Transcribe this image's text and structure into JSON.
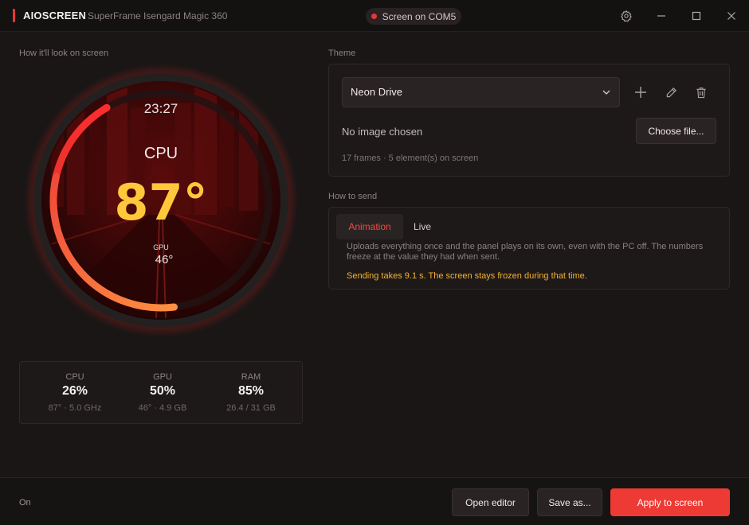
{
  "titlebar": {
    "brand": "AIOSCREEN",
    "device": "SuperFrame Isengard Magic 360",
    "status": "Screen on COM5"
  },
  "preview": {
    "label": "How it'll look on screen",
    "clock": "23:27",
    "primary_label": "CPU",
    "primary_value": "87°",
    "secondary_label": "GPU",
    "secondary_value": "46°",
    "primary_level": 0.87,
    "secondary_level": 0.46
  },
  "stats": [
    {
      "label": "CPU",
      "value": "26%",
      "sub": "87° · 5.0 GHz"
    },
    {
      "label": "GPU",
      "value": "50%",
      "sub": "46° · 4.9 GB"
    },
    {
      "label": "RAM",
      "value": "85%",
      "sub": "26.4 / 31 GB"
    }
  ],
  "theme": {
    "label": "Theme",
    "selected": "Neon Drive",
    "no_image": "No image chosen",
    "choose_file": "Choose file...",
    "meta": "17 frames · 5 element(s) on screen"
  },
  "send": {
    "label": "How to send",
    "tabs": [
      "Animation",
      "Live"
    ],
    "active_tab": "Animation",
    "description": "Uploads everything once and the panel plays on its own, even with the PC off. The numbers freeze at the value they had when sent.",
    "warning": "Sending takes 9.1 s. The screen stays frozen during that time."
  },
  "footer": {
    "status": "On",
    "open_editor": "Open editor",
    "save_as": "Save as...",
    "apply": "Apply to screen"
  },
  "colors": {
    "accent": "#ee3a34",
    "warning": "#f6b12f",
    "gauge_value": "#ffc83a",
    "background": "#1a1616"
  },
  "icons": {
    "settings": "gear-icon",
    "minimize": "minimize-icon",
    "maximize": "maximize-icon",
    "close": "close-icon",
    "add": "plus-icon",
    "edit": "pencil-icon",
    "delete": "trash-icon",
    "dropdown": "chevron-down-icon"
  }
}
